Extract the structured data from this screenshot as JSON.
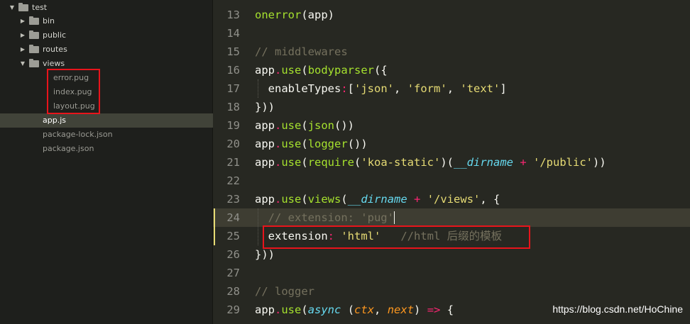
{
  "sidebar": {
    "project": "test",
    "folders": [
      "bin",
      "public",
      "routes",
      "views"
    ],
    "view_files": [
      "error.pug",
      "index.pug",
      "layout.pug"
    ],
    "files": [
      "app.js",
      "package-lock.json",
      "package.json"
    ],
    "selected": "app.js"
  },
  "editor": {
    "lines": [
      {
        "num": "13",
        "tokens": [
          {
            "t": "onerror",
            "c": "f"
          },
          {
            "t": "(app)",
            "c": "n"
          }
        ]
      },
      {
        "num": "14",
        "tokens": []
      },
      {
        "num": "15",
        "tokens": [
          {
            "t": "// middlewares",
            "c": "c"
          }
        ]
      },
      {
        "num": "16",
        "tokens": [
          {
            "t": "app",
            "c": "n"
          },
          {
            "t": ".",
            "c": "o"
          },
          {
            "t": "use",
            "c": "f"
          },
          {
            "t": "(",
            "c": "n"
          },
          {
            "t": "bodyparser",
            "c": "f"
          },
          {
            "t": "({",
            "c": "n"
          }
        ]
      },
      {
        "num": "17",
        "tokens": [
          {
            "t": "  enableTypes",
            "c": "n"
          },
          {
            "t": ":",
            "c": "o"
          },
          {
            "t": "[",
            "c": "n"
          },
          {
            "t": "'json'",
            "c": "s"
          },
          {
            "t": ", ",
            "c": "n"
          },
          {
            "t": "'form'",
            "c": "s"
          },
          {
            "t": ", ",
            "c": "n"
          },
          {
            "t": "'text'",
            "c": "s"
          },
          {
            "t": "]",
            "c": "n"
          }
        ]
      },
      {
        "num": "18",
        "tokens": [
          {
            "t": "}))",
            "c": "n"
          }
        ]
      },
      {
        "num": "19",
        "tokens": [
          {
            "t": "app",
            "c": "n"
          },
          {
            "t": ".",
            "c": "o"
          },
          {
            "t": "use",
            "c": "f"
          },
          {
            "t": "(",
            "c": "n"
          },
          {
            "t": "json",
            "c": "f"
          },
          {
            "t": "())",
            "c": "n"
          }
        ]
      },
      {
        "num": "20",
        "tokens": [
          {
            "t": "app",
            "c": "n"
          },
          {
            "t": ".",
            "c": "o"
          },
          {
            "t": "use",
            "c": "f"
          },
          {
            "t": "(",
            "c": "n"
          },
          {
            "t": "logger",
            "c": "f"
          },
          {
            "t": "())",
            "c": "n"
          }
        ]
      },
      {
        "num": "21",
        "tokens": [
          {
            "t": "app",
            "c": "n"
          },
          {
            "t": ".",
            "c": "o"
          },
          {
            "t": "use",
            "c": "f"
          },
          {
            "t": "(",
            "c": "n"
          },
          {
            "t": "require",
            "c": "f"
          },
          {
            "t": "(",
            "c": "n"
          },
          {
            "t": "'koa-static'",
            "c": "s"
          },
          {
            "t": ")(",
            "c": "n"
          },
          {
            "t": "__dirname",
            "c": "v"
          },
          {
            "t": " + ",
            "c": "o"
          },
          {
            "t": "'/public'",
            "c": "s"
          },
          {
            "t": "))",
            "c": "n"
          }
        ]
      },
      {
        "num": "22",
        "tokens": []
      },
      {
        "num": "23",
        "tokens": [
          {
            "t": "app",
            "c": "n"
          },
          {
            "t": ".",
            "c": "o"
          },
          {
            "t": "use",
            "c": "f"
          },
          {
            "t": "(",
            "c": "n"
          },
          {
            "t": "views",
            "c": "f"
          },
          {
            "t": "(",
            "c": "n"
          },
          {
            "t": "__dirname",
            "c": "v"
          },
          {
            "t": " + ",
            "c": "o"
          },
          {
            "t": "'/views'",
            "c": "s"
          },
          {
            "t": ", {",
            "c": "n"
          }
        ]
      },
      {
        "num": "24",
        "tokens": [
          {
            "t": "  // extension: 'pug'",
            "c": "c"
          }
        ]
      },
      {
        "num": "25",
        "tokens": [
          {
            "t": "  extension",
            "c": "n"
          },
          {
            "t": ":",
            "c": "o"
          },
          {
            "t": " ",
            "c": "n"
          },
          {
            "t": "'html'",
            "c": "s"
          },
          {
            "t": "   //html 后缀的模板",
            "c": "c"
          }
        ]
      },
      {
        "num": "26",
        "tokens": [
          {
            "t": "}))",
            "c": "n"
          }
        ]
      },
      {
        "num": "27",
        "tokens": []
      },
      {
        "num": "28",
        "tokens": [
          {
            "t": "// logger",
            "c": "c"
          }
        ]
      },
      {
        "num": "29",
        "tokens": [
          {
            "t": "app",
            "c": "n"
          },
          {
            "t": ".",
            "c": "o"
          },
          {
            "t": "use",
            "c": "f"
          },
          {
            "t": "(",
            "c": "n"
          },
          {
            "t": "async",
            "c": "v"
          },
          {
            "t": " (",
            "c": "n"
          },
          {
            "t": "ctx",
            "c": "p"
          },
          {
            "t": ", ",
            "c": "n"
          },
          {
            "t": "next",
            "c": "p"
          },
          {
            "t": ") ",
            "c": "n"
          },
          {
            "t": "=>",
            "c": "o"
          },
          {
            "t": " {",
            "c": "n"
          }
        ]
      }
    ]
  },
  "watermark": "https://blog.csdn.net/HoChine",
  "colors": {
    "background": "#272822",
    "sidebar": "#1e1f1c",
    "selection": "#414339",
    "highlight_box": "#e8141b",
    "keyword": "#f92672",
    "function": "#a6e22e",
    "string": "#e6db74",
    "comment": "#75715e"
  },
  "icons": {
    "expanded": "caret-down-icon",
    "collapsed": "caret-right-icon",
    "folder": "folder-icon"
  }
}
